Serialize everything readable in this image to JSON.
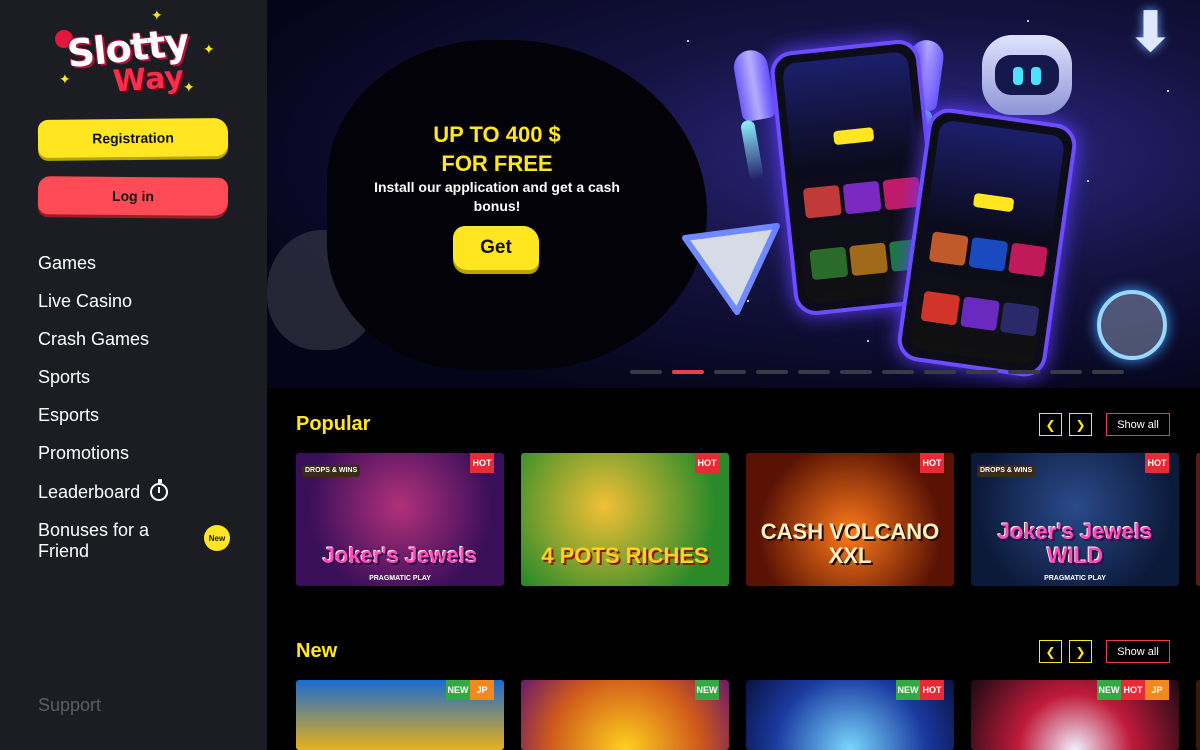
{
  "brand": {
    "logo_line1": "Slotty",
    "logo_line2": "Way"
  },
  "sidebar": {
    "register_label": "Registration",
    "login_label": "Log in",
    "items": [
      {
        "label": "Games"
      },
      {
        "label": "Live Casino"
      },
      {
        "label": "Crash Games"
      },
      {
        "label": "Sports"
      },
      {
        "label": "Esports"
      },
      {
        "label": "Promotions"
      },
      {
        "label": "Leaderboard",
        "icon": "timer-icon"
      },
      {
        "label": "Bonuses for a Friend",
        "badge": "New"
      }
    ],
    "support_label": "Support"
  },
  "banner": {
    "title_line1": "UP TO 400 $",
    "title_line2": "FOR FREE",
    "subtitle": "Install our application and get a cash bonus!",
    "cta_label": "Get",
    "slide_count": 13,
    "active_slide": 2
  },
  "popular": {
    "title": "Popular",
    "prev_icon": "chevron-left-icon",
    "next_icon": "chevron-right-icon",
    "show_all_label": "Show all",
    "cards": [
      {
        "name": "Joker's Jewels",
        "provider": "PRAGMATIC PLAY",
        "badge": "DROPS & WINS",
        "tags": [
          "HOT"
        ]
      },
      {
        "name": "4 POTS RICHES",
        "provider": "",
        "tags": [
          "HOT"
        ]
      },
      {
        "name": "CASH VOLCANO XXL",
        "provider": "",
        "tags": [
          "HOT"
        ]
      },
      {
        "name": "Joker's Jewels WILD",
        "provider": "PRAGMATIC PLAY",
        "badge": "DROPS & WINS",
        "tags": [
          "HOT"
        ]
      }
    ]
  },
  "new_section": {
    "title": "New",
    "prev_icon": "chevron-left-icon",
    "next_icon": "chevron-right-icon",
    "show_all_label": "Show all",
    "cards": [
      {
        "tags": [
          "NEW",
          "JP"
        ]
      },
      {
        "tags": [
          "NEW"
        ]
      },
      {
        "tags": [
          "NEW",
          "HOT"
        ]
      },
      {
        "tags": [
          "NEW",
          "HOT",
          "JP"
        ]
      }
    ]
  },
  "colors": {
    "accent": "#ffe620",
    "danger": "#ff4b55",
    "sidebar_bg": "#1c1d22",
    "page_bg": "#000000"
  }
}
